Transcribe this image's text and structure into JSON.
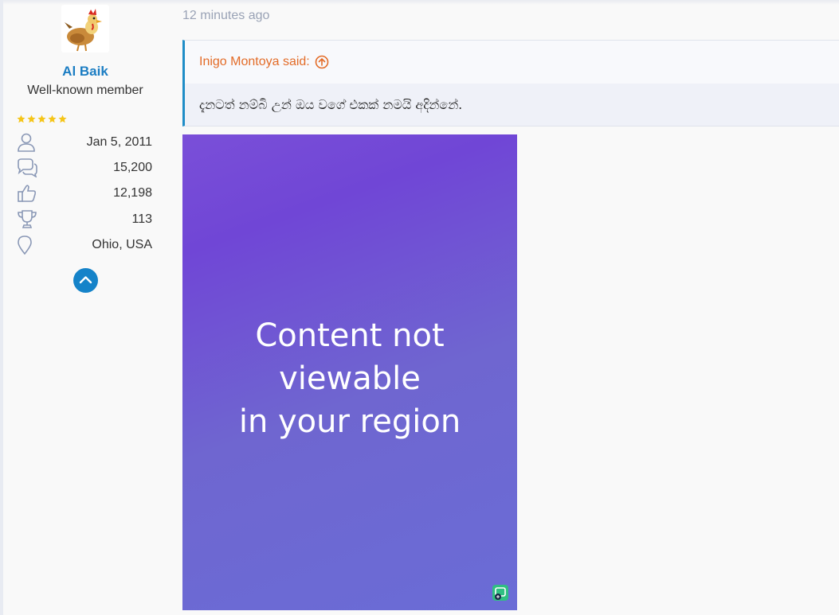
{
  "post": {
    "timestamp": "12 minutes ago"
  },
  "user": {
    "name": "Al Baik",
    "title": "Well-known member",
    "stars": 5,
    "stats": [
      {
        "icon": "user-icon",
        "value": "Jan 5, 2011"
      },
      {
        "icon": "messages-icon",
        "value": "15,200"
      },
      {
        "icon": "thumbs-up-icon",
        "value": "12,198"
      },
      {
        "icon": "trophy-icon",
        "value": "113"
      },
      {
        "icon": "location-pin-icon",
        "value": "Ohio, USA"
      }
    ]
  },
  "quote": {
    "author": "Inigo Montoya said:",
    "text": "දැනටත් නම්බි උන් ඔය වගේ එකක් නමයි අදින්නේ."
  },
  "embed": {
    "message_line1": "Content not viewable",
    "message_line2": "in your region"
  },
  "colors": {
    "accent": "#1b7dc3",
    "quote_author": "#e36c28",
    "star": "#f5c518"
  }
}
